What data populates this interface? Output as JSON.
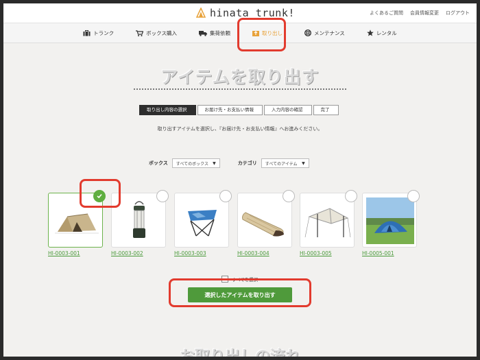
{
  "header": {
    "logo_text": "hinata trunk!",
    "links": [
      "よくあるご質問",
      "会員情報変更",
      "ログアウト"
    ]
  },
  "nav": {
    "items": [
      {
        "label": "トランク",
        "icon": "trunk-icon"
      },
      {
        "label": "ボックス購入",
        "icon": "cart-icon"
      },
      {
        "label": "集荷依頼",
        "icon": "truck-icon"
      },
      {
        "label": "取り出し",
        "icon": "takeout-icon",
        "active": true
      },
      {
        "label": "メンテナンス",
        "icon": "lifebuoy-icon"
      },
      {
        "label": "レンタル",
        "icon": "star-icon"
      }
    ],
    "active_color": "#e8a23a"
  },
  "page": {
    "title": "アイテムを取り出す",
    "steps": [
      "取り出し内容の選択",
      "お届け先・お支払い情報",
      "入力内容の確認",
      "完了"
    ],
    "active_step": 0,
    "description": "取り出すアイテムを選択し、『お届け先・お支払い情報』へお進みください。"
  },
  "filters": {
    "box_label": "ボックス",
    "box_value": "すべてのボックス",
    "category_label": "カテゴリ",
    "category_value": "すべてのアイテム"
  },
  "items": [
    {
      "id": "HI-0003-001",
      "kind": "tent",
      "selected": true
    },
    {
      "id": "HI-0003-002",
      "kind": "lantern",
      "selected": false
    },
    {
      "id": "HI-0003-003",
      "kind": "chair",
      "selected": false
    },
    {
      "id": "HI-0003-004",
      "kind": "sleeping-bag",
      "selected": false
    },
    {
      "id": "HI-0003-005",
      "kind": "tarp",
      "selected": false
    },
    {
      "id": "HI-0005-001",
      "kind": "dome-tent",
      "selected": false
    }
  ],
  "select_all_label": "すべてを選択",
  "submit_label": "選択したアイテムを取り出す",
  "bottom_heading": "お取り出しの流れ",
  "colors": {
    "accent_green": "#4f9a3b",
    "highlight_red": "#e23b2e"
  }
}
